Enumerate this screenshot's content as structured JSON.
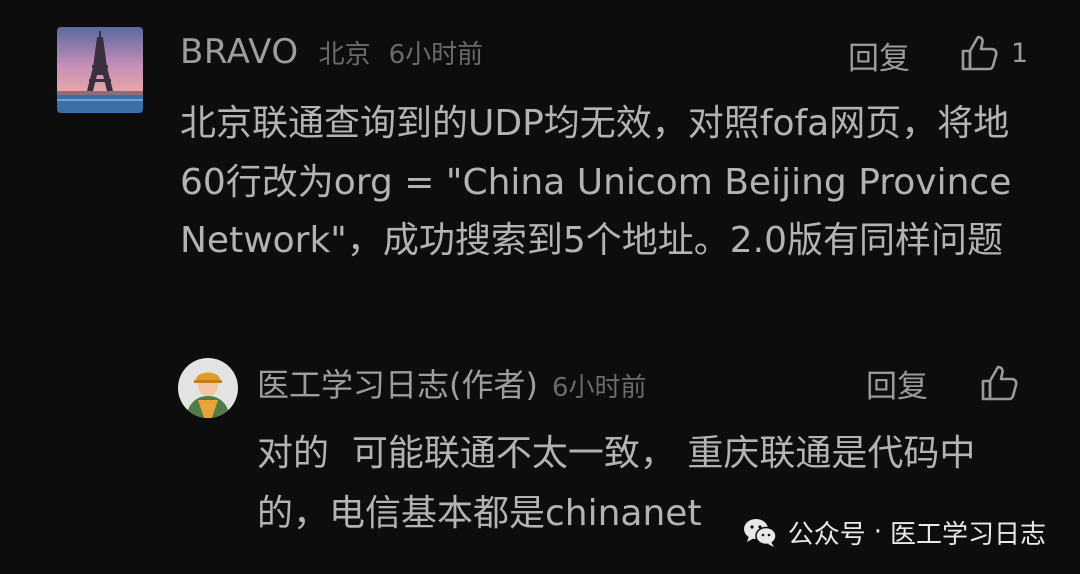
{
  "comment": {
    "username": "BRAVO",
    "location": "北京",
    "time": "6小时前",
    "reply_label": "回复",
    "like_count": "1",
    "content": "北京联通查询到的UDP均无效，对照fofa网页，将地60行改为org = \"China Unicom Beijing Province Network\"，成功搜索到5个地址。2.0版有同样问题"
  },
  "reply": {
    "username": "医工学习日志(作者)",
    "time": "6小时前",
    "reply_label": "回复",
    "content": "对的  可能联通不太一致， 重庆联通是代码中的，电信基本都是chinanet"
  },
  "watermark": {
    "label": "公众号",
    "separator": "·",
    "name": "医工学习日志"
  },
  "icons": {
    "main_avatar": "eiffel-tower-photo-avatar",
    "reply_avatar": "construction-worker-avatar",
    "like": "thumbs-up-icon",
    "watermark": "wechat-icon"
  },
  "colors": {
    "background": "#0d0d0d",
    "text_primary": "#b3b3b3",
    "text_secondary": "#6a6a6a",
    "watermark_text": "#e8e8e8"
  }
}
